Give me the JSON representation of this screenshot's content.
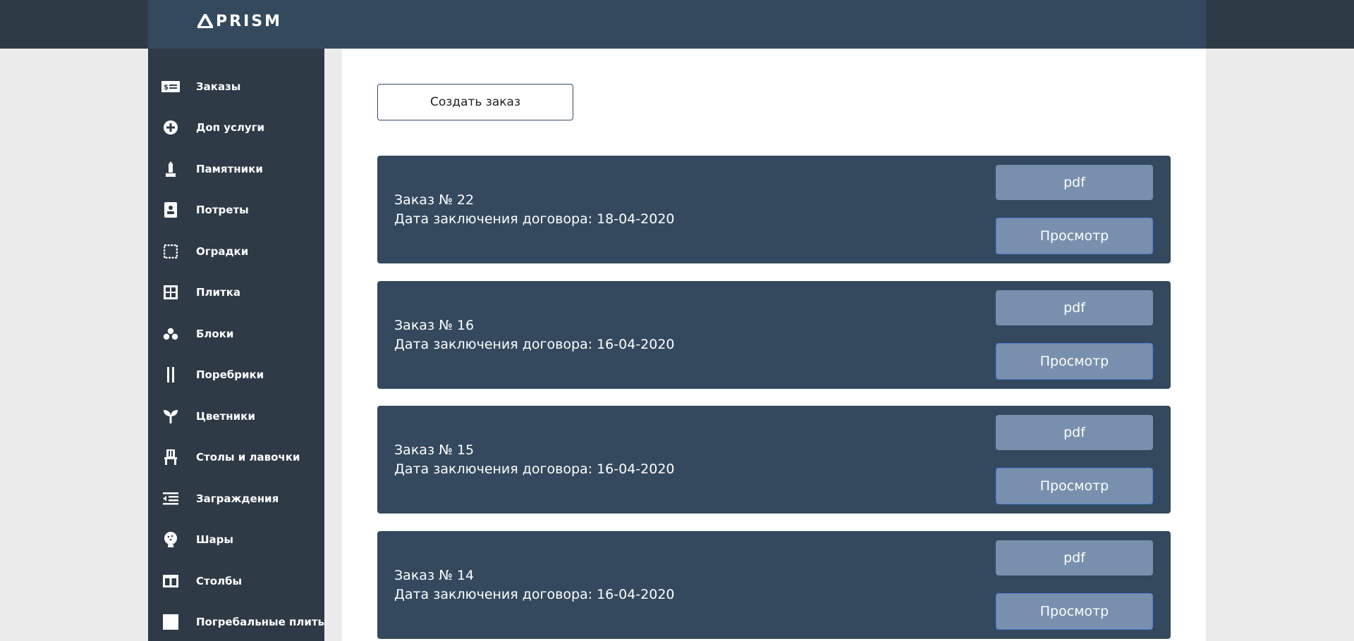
{
  "brand": {
    "logo_text": "PRISM"
  },
  "sidebar": {
    "items": [
      {
        "label": "Заказы",
        "icon": "money-card-icon"
      },
      {
        "label": "Доп услуги",
        "icon": "plus-circle-icon"
      },
      {
        "label": "Памятники",
        "icon": "monument-icon"
      },
      {
        "label": "Потреты",
        "icon": "portrait-icon"
      },
      {
        "label": "Оградки",
        "icon": "fence-frame-icon"
      },
      {
        "label": "Плитка",
        "icon": "tile-grid-icon"
      },
      {
        "label": "Блоки",
        "icon": "blocks-icon"
      },
      {
        "label": "Поребрики",
        "icon": "curb-icon"
      },
      {
        "label": "Цветники",
        "icon": "sprout-icon"
      },
      {
        "label": "Столы и лавочки",
        "icon": "chair-icon"
      },
      {
        "label": "Заграждения",
        "icon": "barrier-list-icon"
      },
      {
        "label": "Шары",
        "icon": "ball-icon"
      },
      {
        "label": "Столбы",
        "icon": "pillars-icon"
      },
      {
        "label": "Погребальные плиты",
        "icon": "slab-icon"
      }
    ]
  },
  "main": {
    "create_button": "Создать заказ",
    "orders": [
      {
        "number": "Заказ № 22",
        "date": "Дата заключения договора: 18-04-2020",
        "pdf_label": "pdf",
        "view_label": "Просмотр"
      },
      {
        "number": "Заказ № 16",
        "date": "Дата заключения договора: 16-04-2020",
        "pdf_label": "pdf",
        "view_label": "Просмотр"
      },
      {
        "number": "Заказ № 15",
        "date": "Дата заключения договора: 16-04-2020",
        "pdf_label": "pdf",
        "view_label": "Просмотр"
      },
      {
        "number": "Заказ № 14",
        "date": "Дата заключения договора: 16-04-2020",
        "pdf_label": "pdf",
        "view_label": "Просмотр"
      }
    ]
  },
  "colors": {
    "header": "#34495e",
    "sidebar": "#2e3a46",
    "card": "#34495e",
    "button": "#7890ad",
    "button_border": "#4e7fe0"
  }
}
